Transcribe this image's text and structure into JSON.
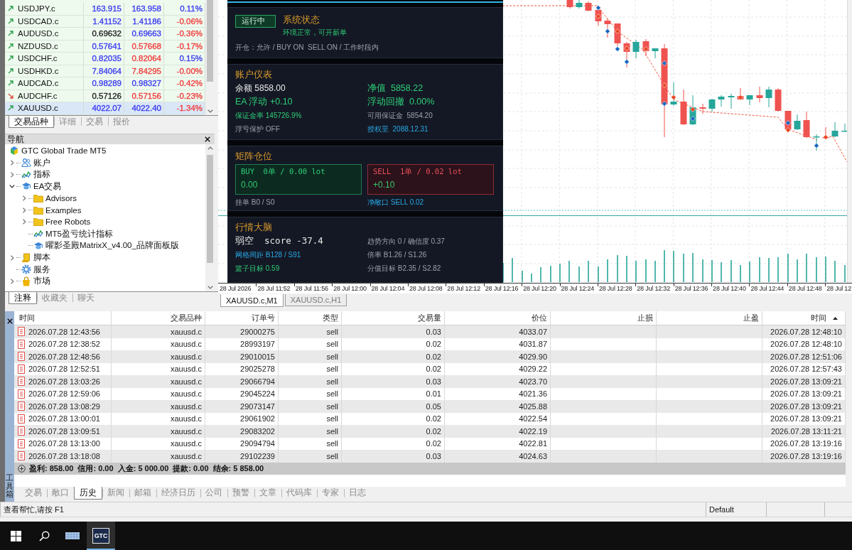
{
  "market_watch": {
    "quotes": [
      {
        "symbol": "USDJPY.c",
        "bid": {
          "text": "163.915",
          "color": "#3c3cf0"
        },
        "ask": {
          "text": "163.958",
          "color": "#3c3cf0"
        },
        "change": {
          "text": "0.11%",
          "color": "#3c3cf0"
        },
        "rising": true,
        "selected": false
      },
      {
        "symbol": "USDCAD.c",
        "bid": {
          "text": "1.41152",
          "color": "#3c3cf0"
        },
        "ask": {
          "text": "1.41186",
          "color": "#3c3cf0"
        },
        "change": {
          "text": "-0.06%",
          "color": "#f03c3c"
        },
        "rising": true,
        "selected": false
      },
      {
        "symbol": "AUDUSD.c",
        "bid": {
          "text": "0.69632",
          "color": "#222222"
        },
        "ask": {
          "text": "0.69663",
          "color": "#3c3cf0"
        },
        "change": {
          "text": "-0.36%",
          "color": "#f03c3c"
        },
        "rising": true,
        "selected": false
      },
      {
        "symbol": "NZDUSD.c",
        "bid": {
          "text": "0.57641",
          "color": "#3c3cf0"
        },
        "ask": {
          "text": "0.57668",
          "color": "#f03c3c"
        },
        "change": {
          "text": "-0.17%",
          "color": "#f03c3c"
        },
        "rising": true,
        "selected": false
      },
      {
        "symbol": "USDCHF.c",
        "bid": {
          "text": "0.82035",
          "color": "#3c3cf0"
        },
        "ask": {
          "text": "0.82064",
          "color": "#f03c3c"
        },
        "change": {
          "text": "0.15%",
          "color": "#3c3cf0"
        },
        "rising": true,
        "selected": false
      },
      {
        "symbol": "USDHKD.c",
        "bid": {
          "text": "7.84064",
          "color": "#3c3cf0"
        },
        "ask": {
          "text": "7.84295",
          "color": "#f03c3c"
        },
        "change": {
          "text": "-0.00%",
          "color": "#f03c3c"
        },
        "rising": true,
        "selected": false
      },
      {
        "symbol": "AUDCAD.c",
        "bid": {
          "text": "0.98289",
          "color": "#3c3cf0"
        },
        "ask": {
          "text": "0.98327",
          "color": "#3c3cf0"
        },
        "change": {
          "text": "-0.42%",
          "color": "#f03c3c"
        },
        "rising": true,
        "selected": false
      },
      {
        "symbol": "AUDCHF.c",
        "bid": {
          "text": "0.57126",
          "color": "#222222"
        },
        "ask": {
          "text": "0.57156",
          "color": "#f03c3c"
        },
        "change": {
          "text": "-0.23%",
          "color": "#f03c3c"
        },
        "rising": false,
        "selected": false
      },
      {
        "symbol": "XAUUSD.c",
        "bid": {
          "text": "4022.07",
          "color": "#3c3cf0"
        },
        "ask": {
          "text": "4022.40",
          "color": "#3c3cf0"
        },
        "change": {
          "text": "-1.34%",
          "color": "#f03c3c"
        },
        "rising": true,
        "selected": true
      }
    ],
    "tabs": [
      {
        "label": "交易品种",
        "selected": true
      },
      {
        "label": "详细",
        "selected": false
      },
      {
        "label": "交易",
        "selected": false
      },
      {
        "label": "报价",
        "selected": false
      }
    ]
  },
  "navigator": {
    "title": "导航",
    "tree": [
      {
        "label": "GTC Global Trade MT5",
        "kind": "terminal",
        "children": [
          {
            "label": "账户",
            "kind": "accounts",
            "expanded": false
          },
          {
            "label": "指标",
            "kind": "indicators",
            "expanded": false
          },
          {
            "label": "EA交易",
            "kind": "experts",
            "expanded": true,
            "children": [
              {
                "label": "Advisors",
                "kind": "folder",
                "expanded": false
              },
              {
                "label": "Examples",
                "kind": "folder",
                "expanded": false
              },
              {
                "label": "Free Robots",
                "kind": "folder",
                "expanded": false
              },
              {
                "label": "MT5盈亏统计指标",
                "kind": "indicators"
              },
              {
                "label": "曜影圣殿MatrixX_v4.00_品牌面板版",
                "kind": "experts"
              }
            ]
          },
          {
            "label": "脚本",
            "kind": "scripts",
            "expanded": false
          },
          {
            "label": "服务",
            "kind": "services"
          },
          {
            "label": "市场",
            "kind": "market",
            "expanded": false
          }
        ]
      }
    ],
    "tabs": [
      {
        "label": "注释",
        "selected": true
      },
      {
        "label": "收藏夹",
        "selected": false
      },
      {
        "label": "聊天",
        "selected": false
      }
    ]
  },
  "chart": {
    "ea_panel": {
      "sections": [
        {
          "kind": "status",
          "state": "运行中",
          "title": "系统状态",
          "message": "环境正常，可开新单",
          "detail": "开仓：允许 / BUY ON  SELL ON / 工作时段内"
        },
        {
          "kind": "metrics",
          "title": "账户仪表",
          "left": [
            {
              "text": "余额 5858.00",
              "kind": "value"
            },
            {
              "text": "EA 浮动 +0.10",
              "kind": "gain"
            },
            {
              "text": "保证金率 145726.9%",
              "kind": "ratio"
            },
            {
              "text": "浮亏保护 OFF",
              "kind": "note"
            }
          ],
          "right": [
            {
              "text": "净值  5858.22",
              "kind": "gain"
            },
            {
              "text": "浮动回撤  0.00%",
              "kind": "gain"
            },
            {
              "text": "可用保证金  5854.20",
              "kind": "note"
            },
            {
              "text": "授权至  2088.12.31",
              "kind": "info"
            }
          ]
        },
        {
          "kind": "positions",
          "title": "矩阵仓位",
          "boxes": [
            {
              "kind": "buy",
              "label": "BUY  0单 / 0.00 lot",
              "value": "0.00"
            },
            {
              "kind": "sell",
              "label": "SELL  1单 / 0.02 lot",
              "value": "+0.10"
            }
          ],
          "left": [
            {
              "text": "挂单 B0 / S0",
              "kind": "note"
            }
          ],
          "right": [
            {
              "text": "净敞口 SELL 0.02",
              "kind": "info"
            }
          ]
        },
        {
          "kind": "metrics",
          "title": "行情大脑",
          "left": [
            {
              "text": "弱空  score -37.4",
              "kind": "signal"
            },
            {
              "text": "网格间距 B128 / S91",
              "kind": "info"
            },
            {
              "text": "篮子目标 0.59",
              "kind": "ratio"
            }
          ],
          "right": [
            {
              "text": "趋势方向 0 / 确信度 0.37",
              "kind": "note"
            },
            {
              "text": "倍率 B1.26 / S1.26",
              "kind": "note"
            },
            {
              "text": "分值目标 B2.35 / S2.82",
              "kind": "note"
            }
          ]
        }
      ]
    },
    "time_axis": [
      "28 Jul 2026",
      "28 Jul 11:52",
      "28 Jul 11:56",
      "28 Jul 12:00",
      "28 Jul 12:04",
      "28 Jul 12:08",
      "28 Jul 12:12",
      "28 Jul 12:16",
      "28 Jul 12:20",
      "28 Jul 12:24",
      "28 Jul 12:28",
      "28 Jul 12:32",
      "28 Jul 12:36",
      "28 Jul 12:40",
      "28 Jul 12:44",
      "28 Jul 12:48",
      "28 Jul 12"
    ],
    "tabs": [
      {
        "label": "XAUUSD.c,M1",
        "selected": true
      },
      {
        "label": "XAUUSD.c,H1",
        "selected": false
      }
    ]
  },
  "toolbox": {
    "title": "工具箱",
    "history": {
      "columns": [
        {
          "label": "时间",
          "sorted": false
        },
        {
          "label": "交易品种",
          "sorted": false
        },
        {
          "label": "订单号",
          "sorted": false
        },
        {
          "label": "类型",
          "sorted": false
        },
        {
          "label": "交易量",
          "sorted": false
        },
        {
          "label": "价位",
          "sorted": false
        },
        {
          "label": "止损",
          "sorted": false
        },
        {
          "label": "止盈",
          "sorted": false
        },
        {
          "label": "时间",
          "sorted": true
        }
      ],
      "rows": [
        {
          "time": "2026.07.28 12:43:56",
          "symbol": "xauusd.c",
          "ticket": "29000275",
          "type": "sell",
          "volume": "0.03",
          "price": "4033.07",
          "close_time": "2026.07.28 12:48:10"
        },
        {
          "time": "2026.07.28 12:38:52",
          "symbol": "xauusd.c",
          "ticket": "28993197",
          "type": "sell",
          "volume": "0.02",
          "price": "4031.87",
          "close_time": "2026.07.28 12:48:10"
        },
        {
          "time": "2026.07.28 12:48:56",
          "symbol": "xauusd.c",
          "ticket": "29010015",
          "type": "sell",
          "volume": "0.02",
          "price": "4029.90",
          "close_time": "2026.07.28 12:51:06"
        },
        {
          "time": "2026.07.28 12:52:51",
          "symbol": "xauusd.c",
          "ticket": "29025278",
          "type": "sell",
          "volume": "0.02",
          "price": "4029.22",
          "close_time": "2026.07.28 12:57:43"
        },
        {
          "time": "2026.07.28 13:03:26",
          "symbol": "xauusd.c",
          "ticket": "29066794",
          "type": "sell",
          "volume": "0.03",
          "price": "4023.70",
          "close_time": "2026.07.28 13:09:21"
        },
        {
          "time": "2026.07.28 12:59:06",
          "symbol": "xauusd.c",
          "ticket": "29045224",
          "type": "sell",
          "volume": "0.01",
          "price": "4021.36",
          "close_time": "2026.07.28 13:09:21"
        },
        {
          "time": "2026.07.28 13:08:29",
          "symbol": "xauusd.c",
          "ticket": "29073147",
          "type": "sell",
          "volume": "0.05",
          "price": "4025.88",
          "close_time": "2026.07.28 13:09:21"
        },
        {
          "time": "2026.07.28 13:00:01",
          "symbol": "xauusd.c",
          "ticket": "29061902",
          "type": "sell",
          "volume": "0.02",
          "price": "4022.54",
          "close_time": "2026.07.28 13:09:21"
        },
        {
          "time": "2026.07.28 13:09:51",
          "symbol": "xauusd.c",
          "ticket": "29083202",
          "type": "sell",
          "volume": "0.02",
          "price": "4022.19",
          "close_time": "2026.07.28 13:11:21"
        },
        {
          "time": "2026.07.28 13:13:00",
          "symbol": "xauusd.c",
          "ticket": "29094794",
          "type": "sell",
          "volume": "0.02",
          "price": "4022.81",
          "close_time": "2026.07.28 13:19:16"
        },
        {
          "time": "2026.07.28 13:18:08",
          "symbol": "xauusd.c",
          "ticket": "29102239",
          "type": "sell",
          "volume": "0.03",
          "price": "4024.63",
          "close_time": "2026.07.28 13:19:16"
        }
      ],
      "summary": "盈利: 858.00  信用: 0.00  入金: 5 000.00  提款: 0.00  结余: 5 858.00"
    },
    "tabs": [
      {
        "label": "交易",
        "selected": false
      },
      {
        "label": "敞口",
        "selected": false
      },
      {
        "label": "历史",
        "selected": true
      },
      {
        "label": "新闻",
        "selected": false
      },
      {
        "label": "邮箱",
        "selected": false
      },
      {
        "label": "经济日历",
        "selected": false
      },
      {
        "label": "公司",
        "selected": false
      },
      {
        "label": "预警",
        "selected": false
      },
      {
        "label": "文章",
        "selected": false
      },
      {
        "label": "代码库",
        "selected": false
      },
      {
        "label": "专家",
        "selected": false
      },
      {
        "label": "日志",
        "selected": false
      }
    ]
  },
  "status_bar": {
    "help": "查看帮忙,请按 F1",
    "profile": "Default"
  },
  "taskbar": {
    "items": [
      {
        "kind": "start",
        "selected": false
      },
      {
        "kind": "search",
        "selected": false
      },
      {
        "kind": "keyboard",
        "selected": false
      },
      {
        "kind": "app",
        "label": "GTC",
        "selected": true
      }
    ]
  }
}
